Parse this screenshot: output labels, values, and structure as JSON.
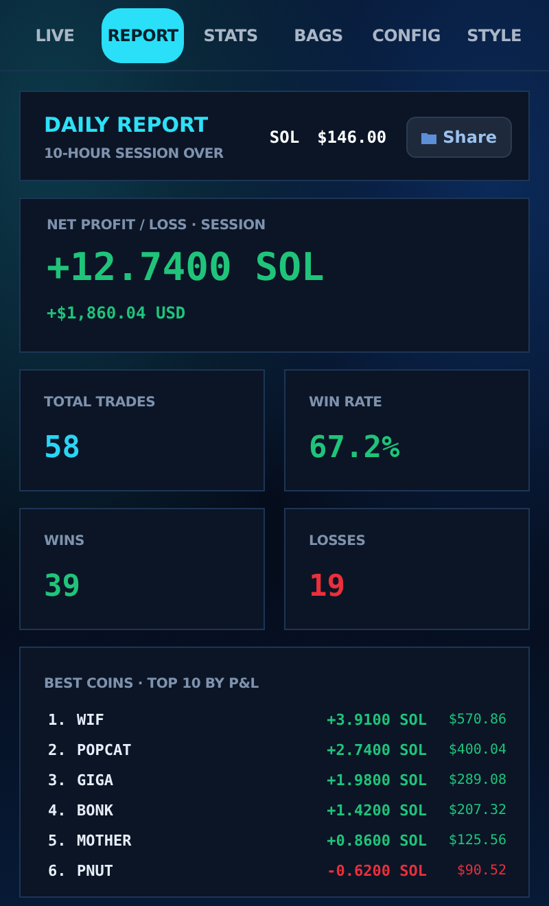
{
  "tabs": [
    {
      "label": "LIVE",
      "selected": false
    },
    {
      "label": "REPORT",
      "selected": true
    },
    {
      "label": "STATS",
      "selected": false
    },
    {
      "label": "BAGS",
      "selected": false
    },
    {
      "label": "CONFIG",
      "selected": false
    },
    {
      "label": "STYLE",
      "selected": false
    }
  ],
  "header": {
    "title": "DAILY REPORT",
    "subtitle": "10-HOUR SESSION OVER",
    "token": "SOL",
    "price": "$146.00",
    "share_button": "Share"
  },
  "net": {
    "label": "NET PROFIT / LOSS · SESSION",
    "value": "+12.7400 SOL",
    "usd": "+$1,860.04 USD"
  },
  "stats": [
    {
      "label": "TOTAL TRADES",
      "value": "58",
      "color": "#2ad4f5"
    },
    {
      "label": "WIN RATE",
      "value": "67.2%",
      "color": "#1fc47a"
    },
    {
      "label": "WINS",
      "value": "39",
      "color": "#1fc47a"
    },
    {
      "label": "LOSSES",
      "value": "19",
      "color": "#ec2f3b"
    }
  ],
  "coins": {
    "label": "BEST COINS · TOP 10 BY P&L",
    "rows": [
      {
        "rank": "1.",
        "name": "WIF",
        "sol": "+3.9100 SOL",
        "usd": "$570.86",
        "kind": "gain"
      },
      {
        "rank": "2.",
        "name": "POPCAT",
        "sol": "+2.7400 SOL",
        "usd": "$400.04",
        "kind": "gain"
      },
      {
        "rank": "3.",
        "name": "GIGA",
        "sol": "+1.9800 SOL",
        "usd": "$289.08",
        "kind": "gain"
      },
      {
        "rank": "4.",
        "name": "BONK",
        "sol": "+1.4200 SOL",
        "usd": "$207.32",
        "kind": "gain"
      },
      {
        "rank": "5.",
        "name": "MOTHER",
        "sol": "+0.8600 SOL",
        "usd": "$125.56",
        "kind": "gain"
      },
      {
        "rank": "6.",
        "name": "PNUT",
        "sol": "-0.6200 SOL",
        "usd": "$90.52",
        "kind": "loss"
      }
    ]
  }
}
